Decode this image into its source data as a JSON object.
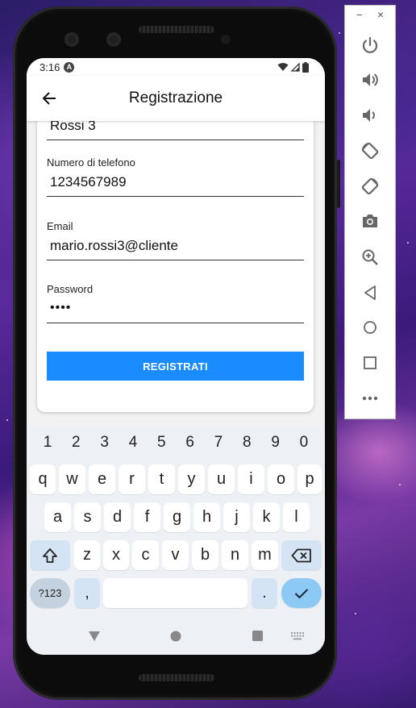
{
  "status_bar": {
    "time": "3:16",
    "notification_badge": "A"
  },
  "app_bar": {
    "title": "Registrazione"
  },
  "form": {
    "fields": [
      {
        "label": "",
        "value": "Rossi 3"
      },
      {
        "label": "Numero di telefono",
        "value": "1234567989"
      },
      {
        "label": "Email",
        "value": "mario.rossi3@cliente"
      },
      {
        "label": "Password",
        "value": "••••"
      }
    ],
    "submit_label": "REGISTRATI",
    "accent_color": "#1a8cff"
  },
  "keyboard": {
    "numbers": [
      "1",
      "2",
      "3",
      "4",
      "5",
      "6",
      "7",
      "8",
      "9",
      "0"
    ],
    "row1": [
      "q",
      "w",
      "e",
      "r",
      "t",
      "y",
      "u",
      "i",
      "o",
      "p"
    ],
    "row2": [
      "a",
      "s",
      "d",
      "f",
      "g",
      "h",
      "j",
      "k",
      "l"
    ],
    "row3": [
      "z",
      "x",
      "c",
      "v",
      "b",
      "n",
      "m"
    ],
    "symbols_label": "?123",
    "comma": ",",
    "period": "."
  },
  "emulator_toolbar": {
    "minimize": "−",
    "close": "×"
  }
}
